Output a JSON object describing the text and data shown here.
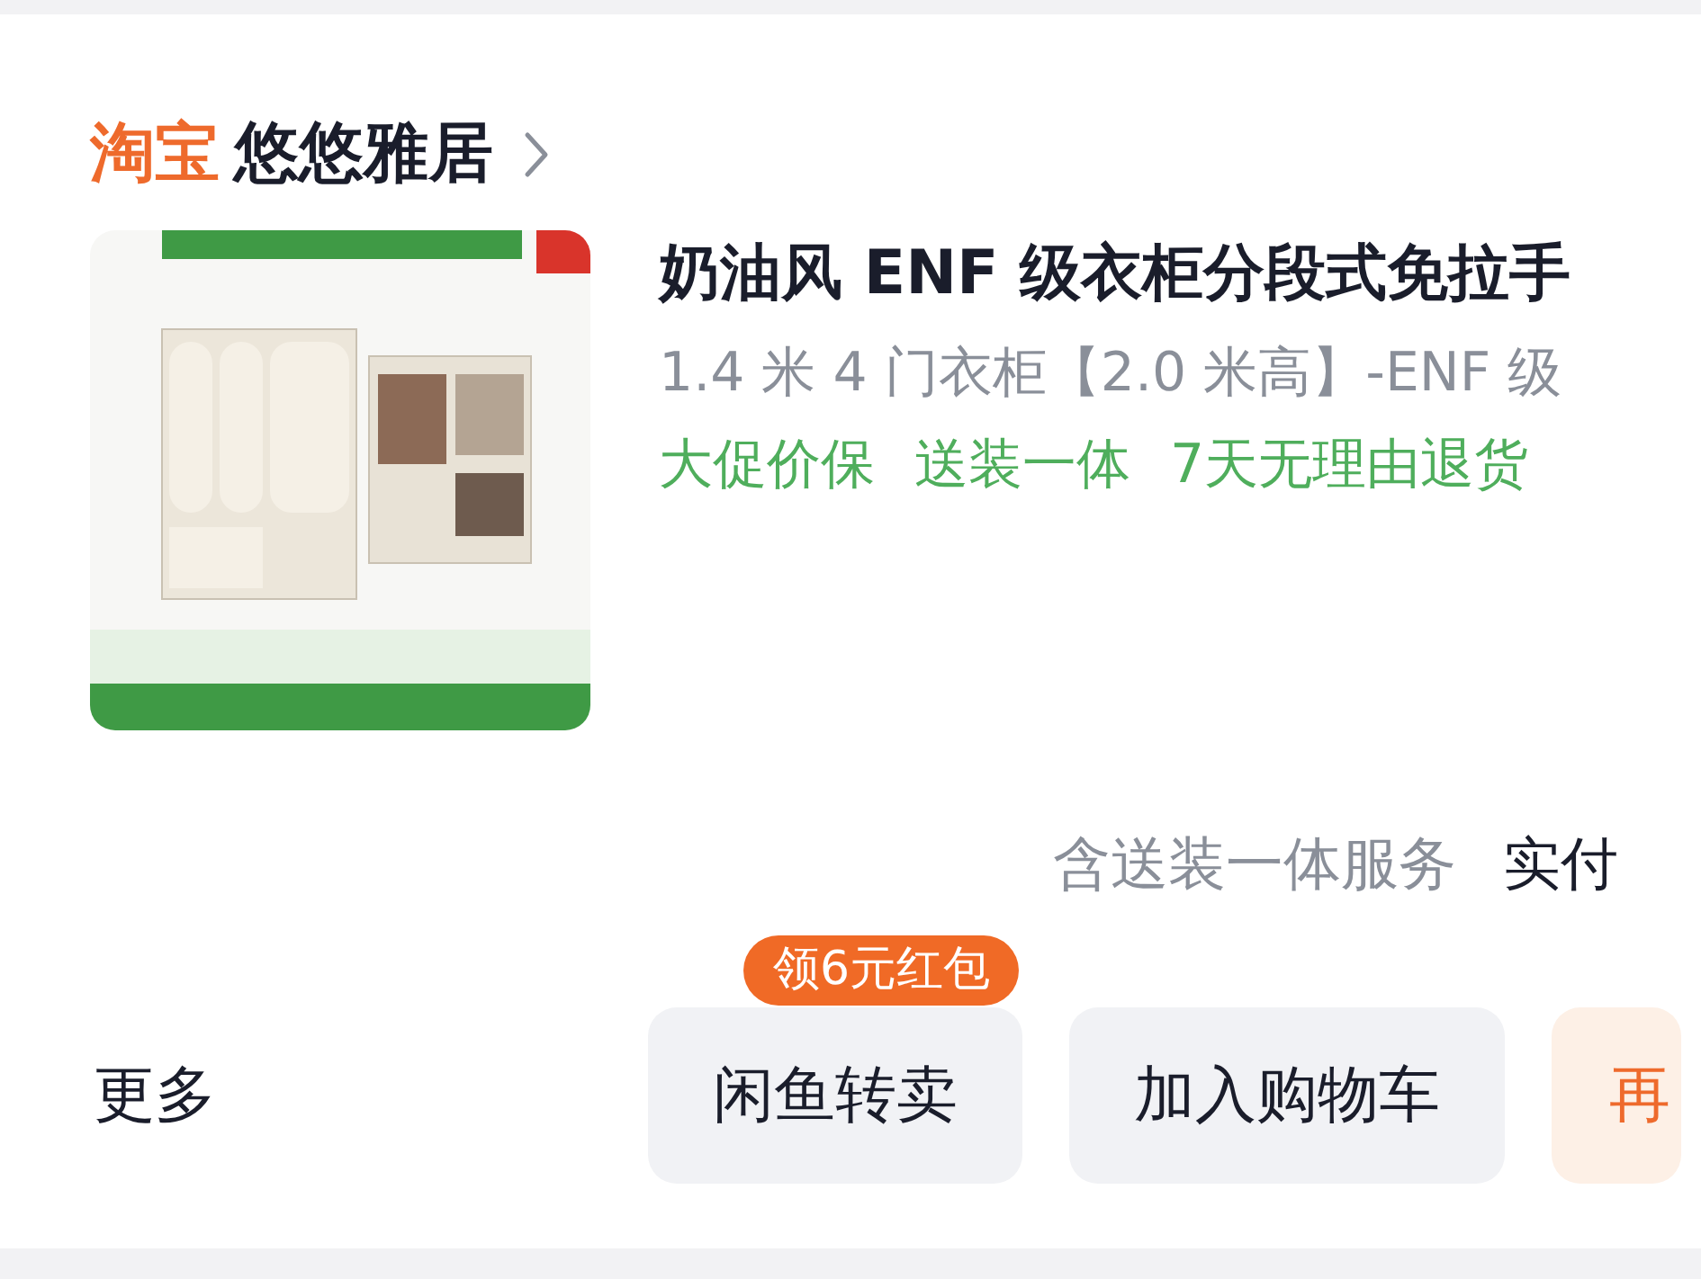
{
  "shop": {
    "logo": "淘宝",
    "name": "悠悠雅居"
  },
  "order": {
    "title": "奶油风 ENF 级衣柜分段式免拉手",
    "sku": "1.4 米 4 门衣柜【2.0 米高】-ENF 级",
    "tags": [
      "大促价保",
      "送装一体",
      "7天无理由退货"
    ],
    "service_note": "含送装一体服务",
    "paid_label": "实付"
  },
  "actions": {
    "more": "更多",
    "buttons": [
      {
        "label": "闲鱼转卖",
        "kind": "secondary",
        "badge": "领6元红包"
      },
      {
        "label": "加入购物车",
        "kind": "secondary"
      },
      {
        "label": "再",
        "kind": "primary"
      }
    ]
  }
}
